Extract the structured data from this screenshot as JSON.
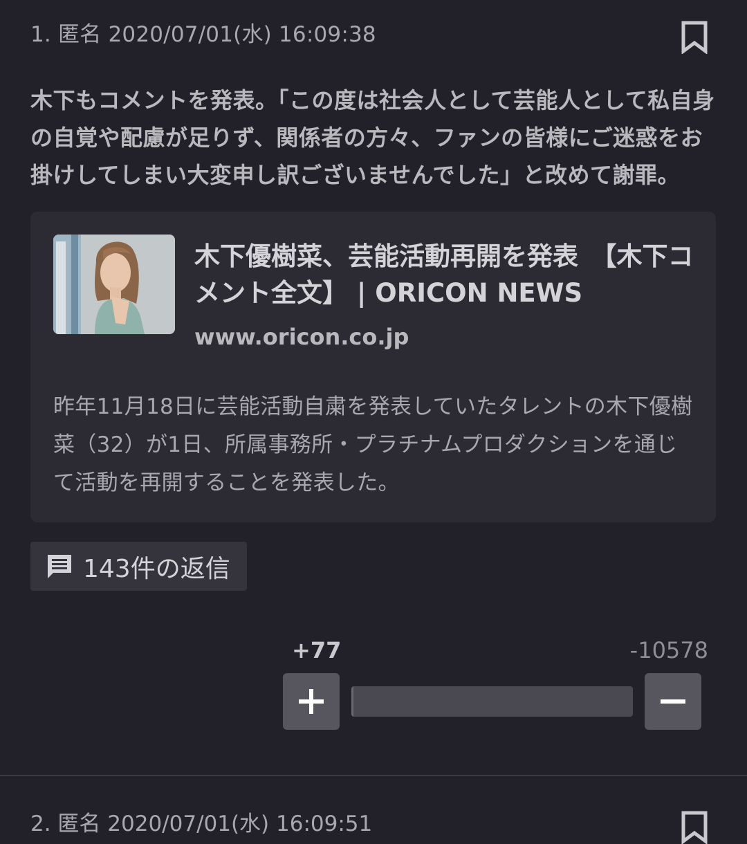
{
  "post": {
    "header": "1. 匿名 2020/07/01(水) 16:09:38",
    "body": "木下もコメントを発表。「この度は社会人として芸能人として私自身の自覚や配慮が足りず、関係者の方々、ファンの皆様にご迷惑をお掛けしてしまい大変申し訳ございませんでした」と改めて謝罪。",
    "icons": {
      "bookmark": "bookmark-icon",
      "reply": "comment-icon"
    }
  },
  "link_card": {
    "title": "木下優樹菜、芸能活動再開を発表　【木下コメント全文】 | ORICON NEWS",
    "domain": "www.oricon.co.jp",
    "description": "昨年11月18日に芸能活動自粛を発表していたタレントの木下優樹菜（32）が1日、所属事務所・プラチナムプロダクションを通じて活動を再開することを発表した。"
  },
  "replies": {
    "label": "143件の返信"
  },
  "votes": {
    "plus": "+77",
    "minus": "-10578",
    "plus_share": 0.007
  },
  "next_post": {
    "header": "2. 匿名 2020/07/01(水) 16:09:51"
  },
  "colors": {
    "background": "#22212a",
    "card": "#2c2b33",
    "button": "#57565e"
  }
}
